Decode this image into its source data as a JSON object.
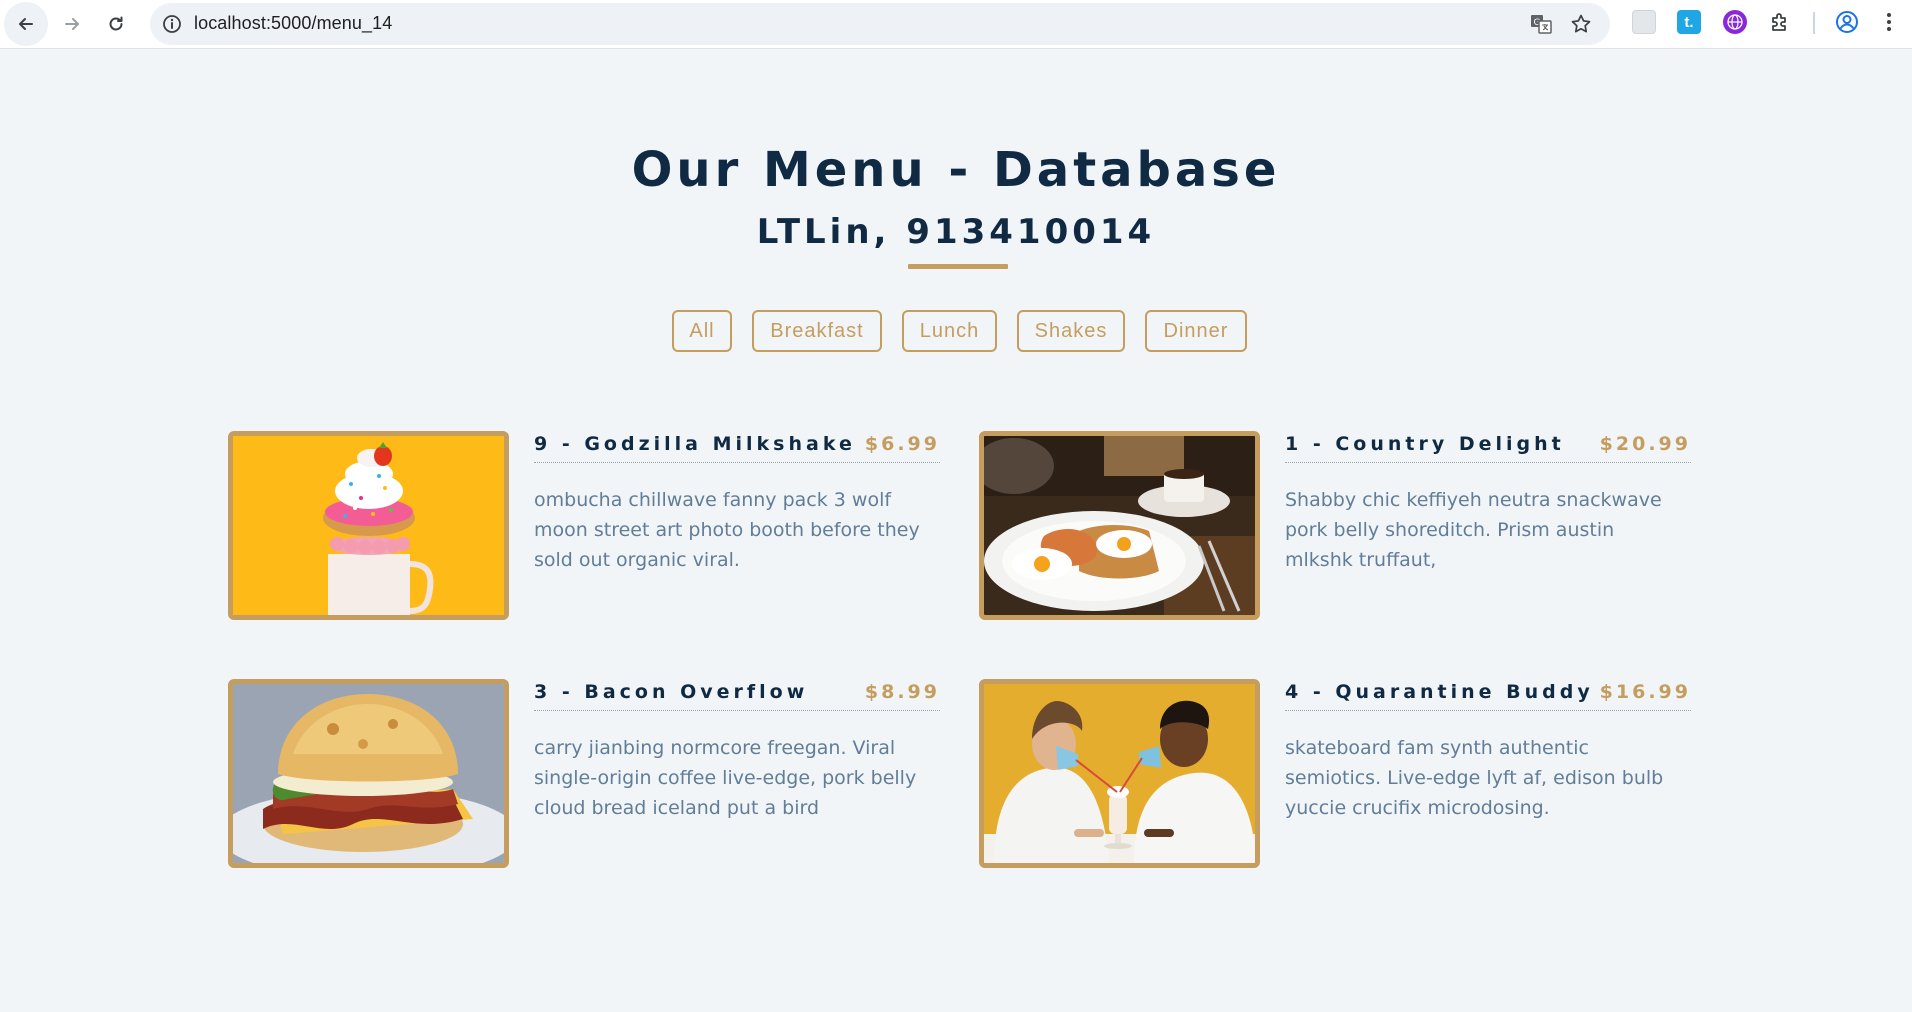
{
  "browser": {
    "url": "localhost:5000/menu_14",
    "ext_t_label": "t."
  },
  "page": {
    "title": "Our Menu - Database",
    "subtitle": "LTLin, 913410014"
  },
  "filters": [
    {
      "label": "All"
    },
    {
      "label": "Breakfast"
    },
    {
      "label": "Lunch"
    },
    {
      "label": "Shakes"
    },
    {
      "label": "Dinner"
    }
  ],
  "menu": [
    {
      "name": "9 - Godzilla Milkshake",
      "price": "$6.99",
      "desc": "ombucha chillwave fanny pack 3 wolf moon street art photo booth before they sold out organic viral.",
      "image": "milkshake-photo"
    },
    {
      "name": "1 - Country Delight",
      "price": "$20.99",
      "desc": "Shabby chic keffiyeh neutra snackwave pork belly shoreditch. Prism austin mlkshk truffaut,",
      "image": "breakfast-plate-photo"
    },
    {
      "name": "3 - Bacon Overflow",
      "price": "$8.99",
      "desc": "carry jianbing normcore freegan. Viral single-origin coffee live-edge, pork belly cloud bread iceland put a bird",
      "image": "bacon-biscuit-photo"
    },
    {
      "name": "4 - Quarantine Buddy",
      "price": "$16.99",
      "desc": "skateboard fam synth authentic semiotics. Live-edge lyft af, edison bulb yuccie crucifix microdosing.",
      "image": "couple-milkshake-photo"
    }
  ],
  "colors": {
    "primary": "#102a43",
    "accent": "#c59d5f",
    "text_muted": "#617d98",
    "background": "#f1f5f8"
  }
}
